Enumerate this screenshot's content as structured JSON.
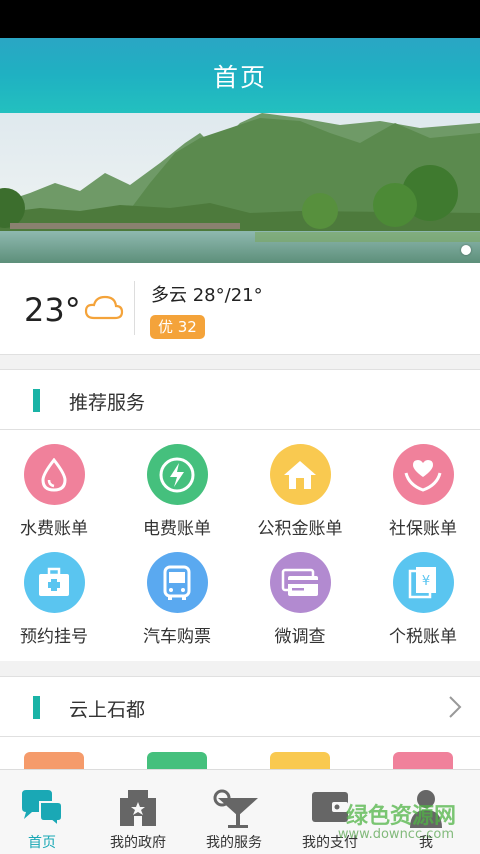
{
  "header": {
    "title": "首页"
  },
  "weather": {
    "temperature": "23°",
    "description": "多云 28°/21°",
    "aqi": "优 32"
  },
  "recommended": {
    "title": "推荐服务",
    "items": [
      {
        "label": "水费账单",
        "icon": "water-drop-icon",
        "color": "#f0819b"
      },
      {
        "label": "电费账单",
        "icon": "lightning-icon",
        "color": "#45c07d"
      },
      {
        "label": "公积金账单",
        "icon": "house-icon",
        "color": "#f9c950"
      },
      {
        "label": "社保账单",
        "icon": "heart-hands-icon",
        "color": "#f0819b"
      },
      {
        "label": "预约挂号",
        "icon": "medical-kit-icon",
        "color": "#5ac5f0"
      },
      {
        "label": "汽车购票",
        "icon": "bus-icon",
        "color": "#5aa9f0"
      },
      {
        "label": "微调查",
        "icon": "survey-cards-icon",
        "color": "#b28ad0"
      },
      {
        "label": "个税账单",
        "icon": "tax-yen-icon",
        "color": "#5ac5f0"
      }
    ]
  },
  "cloud_section": {
    "title": "云上石都"
  },
  "tabbar": {
    "items": [
      {
        "label": "首页",
        "icon": "chat-bubbles-icon"
      },
      {
        "label": "我的政府",
        "icon": "government-building-icon"
      },
      {
        "label": "我的服务",
        "icon": "cocktail-icon"
      },
      {
        "label": "我的支付",
        "icon": "wallet-icon"
      },
      {
        "label": "我",
        "icon": "person-icon"
      }
    ]
  },
  "watermark": {
    "text": "绿色资源网",
    "url": "www.downcc.com"
  },
  "colors": {
    "accent": "#1ab3a6",
    "header": "#22b2c2",
    "aqi": "#f4a33a"
  }
}
